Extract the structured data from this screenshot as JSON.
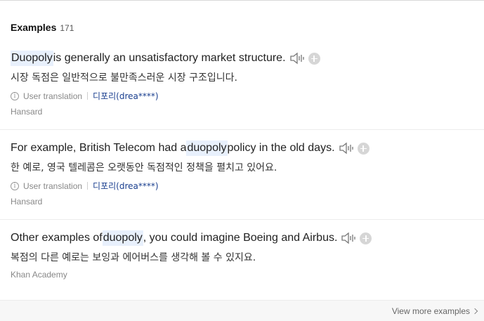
{
  "header": {
    "title": "Examples",
    "count": "171"
  },
  "examples": [
    {
      "pre": "",
      "highlight": "Duopoly",
      "post": " is generally an unsatisfactory market structure.",
      "translation": "시장 독점은 일반적으로 불만족스러운 시장 구조입니다.",
      "user_translation_label": "User translation",
      "user": "디포리(drea****)",
      "source": "Hansard"
    },
    {
      "pre": "For example, British Telecom had a ",
      "highlight": "duopoly",
      "post": " policy in the old days.",
      "translation": "한 예로, 영국 텔레콤은 오랫동안 독점적인 정책을 펼치고 있어요.",
      "user_translation_label": "User translation",
      "user": "디포리(drea****)",
      "source": "Hansard"
    },
    {
      "pre": "Other examples of ",
      "highlight": "duopoly",
      "post": ", you could imagine Boeing and Airbus.",
      "translation": "복점의 다른 예로는 보잉과 에어버스를 생각해 볼 수 있지요.",
      "source": "Khan Academy"
    }
  ],
  "footer": {
    "more_label": "View more examples"
  },
  "icons": {
    "speaker": "speaker-icon",
    "add": "plus-icon",
    "info": "info-icon",
    "chevron": "chevron-right-icon"
  }
}
